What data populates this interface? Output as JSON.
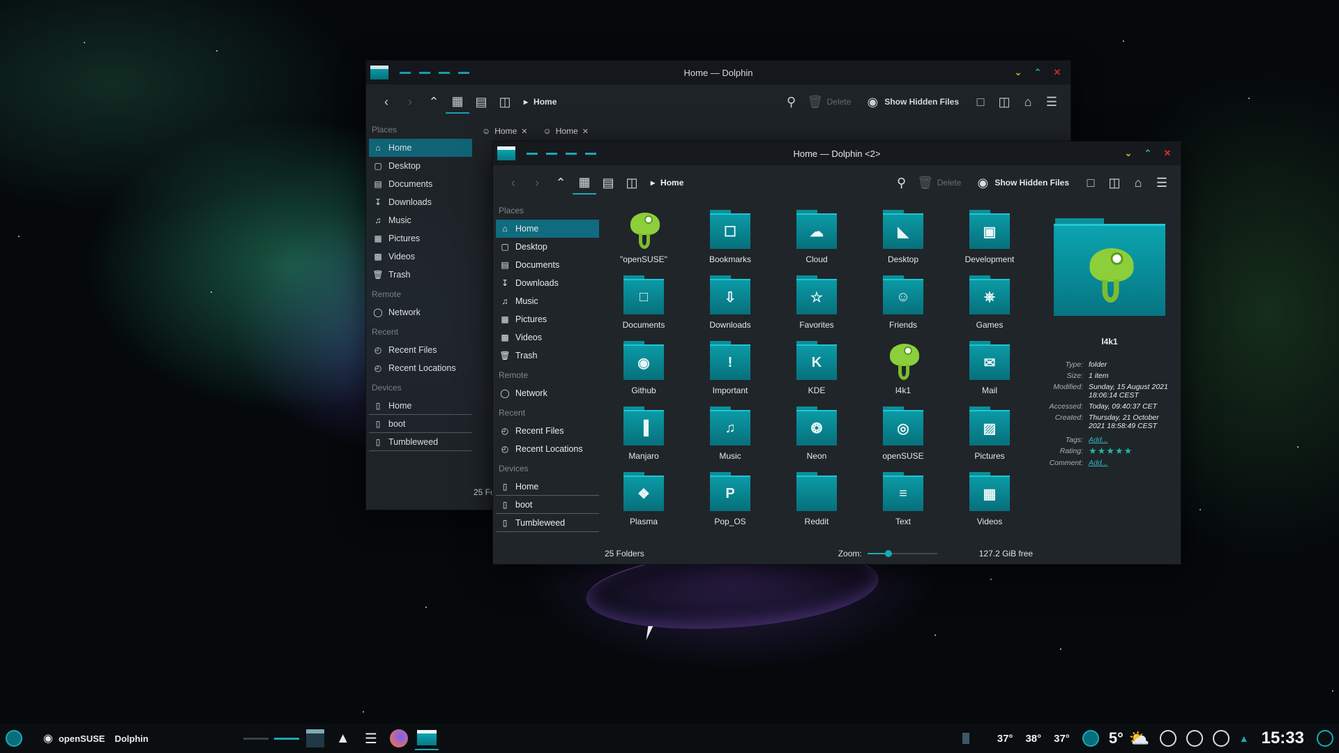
{
  "back_window": {
    "title": "Home — Dolphin",
    "toolbar": {
      "crumb": "Home",
      "delete_label": "Delete",
      "hidden_label": "Show Hidden Files"
    },
    "tabs": [
      "Home",
      "Home"
    ],
    "places_heading": "Places",
    "places": [
      "Home",
      "Desktop",
      "Documents",
      "Downloads",
      "Music",
      "Pictures",
      "Videos",
      "Trash"
    ],
    "remote_heading": "Remote",
    "remote": [
      "Network"
    ],
    "recent_heading": "Recent",
    "recent": [
      "Recent Files",
      "Recent Locations"
    ],
    "devices_heading": "Devices",
    "devices": [
      "Home",
      "boot",
      "Tumbleweed"
    ],
    "status_text": "25 Fo"
  },
  "front_window": {
    "title": "Home — Dolphin <2>",
    "toolbar": {
      "crumb": "Home",
      "delete_label": "Delete",
      "hidden_label": "Show Hidden Files"
    },
    "places_heading": "Places",
    "places": [
      "Home",
      "Desktop",
      "Documents",
      "Downloads",
      "Music",
      "Pictures",
      "Videos",
      "Trash"
    ],
    "remote_heading": "Remote",
    "remote": [
      "Network"
    ],
    "recent_heading": "Recent",
    "recent": [
      "Recent Files",
      "Recent Locations"
    ],
    "devices_heading": "Devices",
    "devices": [
      "Home",
      "boot",
      "Tumbleweed"
    ],
    "folders": [
      {
        "label": "\"openSUSE\"",
        "icon": "chameleon"
      },
      {
        "label": "Bookmarks",
        "icon": "bookmark"
      },
      {
        "label": "Cloud",
        "icon": "cloud"
      },
      {
        "label": "Desktop",
        "icon": "desktop"
      },
      {
        "label": "Development",
        "icon": "development"
      },
      {
        "label": "Documents",
        "icon": "document"
      },
      {
        "label": "Downloads",
        "icon": "download"
      },
      {
        "label": "Favorites",
        "icon": "star"
      },
      {
        "label": "Friends",
        "icon": "friends"
      },
      {
        "label": "Games",
        "icon": "gamepad"
      },
      {
        "label": "Github",
        "icon": "github"
      },
      {
        "label": "Important",
        "icon": "exclamation"
      },
      {
        "label": "KDE",
        "icon": "kde"
      },
      {
        "label": "l4k1",
        "icon": "chameleon"
      },
      {
        "label": "Mail",
        "icon": "mail"
      },
      {
        "label": "Manjaro",
        "icon": "manjaro"
      },
      {
        "label": "Music",
        "icon": "music"
      },
      {
        "label": "Neon",
        "icon": "neon"
      },
      {
        "label": "openSUSE",
        "icon": "opensuse"
      },
      {
        "label": "Pictures",
        "icon": "picture"
      },
      {
        "label": "Plasma",
        "icon": "plasma"
      },
      {
        "label": "Pop_OS",
        "icon": "popos"
      },
      {
        "label": "Reddit",
        "icon": "reddit"
      },
      {
        "label": "Text",
        "icon": "text"
      },
      {
        "label": "Videos",
        "icon": "video"
      }
    ],
    "status": {
      "count": "25 Folders",
      "zoom_label": "Zoom:",
      "free_space": "127.2 GiB free",
      "zoom_level": 0.3
    },
    "info_panel": {
      "name": "l4k1",
      "rows": [
        {
          "k": "Type:",
          "v": "folder"
        },
        {
          "k": "Size:",
          "v": "1 item"
        },
        {
          "k": "Modified:",
          "v": "Sunday, 15 August 2021 18:06:14 CEST"
        },
        {
          "k": "Accessed:",
          "v": "Today, 09:40:37 CET"
        },
        {
          "k": "Created:",
          "v": "Thursday, 21 October 2021 18:58:49 CEST"
        }
      ],
      "tags_label": "Tags:",
      "tags_value": "Add...",
      "rating_label": "Rating:",
      "rating_value": 5,
      "comment_label": "Comment:",
      "comment_value": "Add..."
    }
  },
  "taskbar": {
    "distro_label": "openSUSE",
    "app_label": "Dolphin",
    "temps": [
      "37°",
      "38°",
      "37°"
    ],
    "weather_temp": "5°",
    "clock": "15:33"
  }
}
